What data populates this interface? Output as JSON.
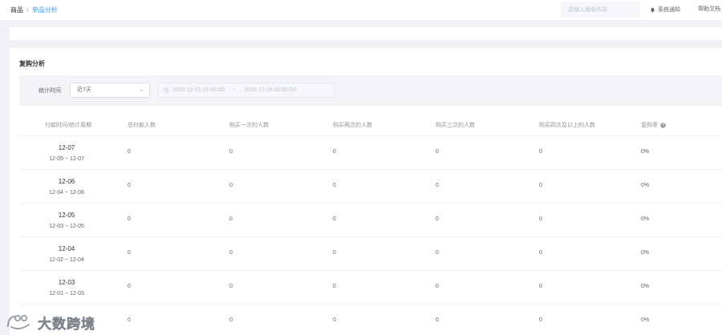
{
  "header": {
    "breadcrumb": {
      "root": "商品",
      "separator": "/",
      "current": "单品分析"
    },
    "search": {
      "placeholder": "请输入搜索内容",
      "value": ""
    },
    "notice_label": "系统通知",
    "help_label": "帮助文档"
  },
  "panel": {
    "title": "复购分析",
    "filter": {
      "label": "统计时间",
      "period": "近7天",
      "range_start": "2020-12-01 00:00:00",
      "range_separator": "~",
      "range_end": "2020-12-08 00:00:00"
    },
    "table": {
      "columns": [
        "付款时间/统计周期",
        "总付款人数",
        "购买一次的人数",
        "购买两次的人数",
        "购买三次的人数",
        "购买四次及以上的人数",
        "复购率"
      ],
      "rows": [
        {
          "period": "12-07",
          "range": "12-05 ~ 12-07",
          "total": "0",
          "once": "0",
          "twice": "0",
          "thrice": "0",
          "four_plus": "0",
          "rate": "0%"
        },
        {
          "period": "12-06",
          "range": "12-04 ~ 12-06",
          "total": "0",
          "once": "0",
          "twice": "0",
          "thrice": "0",
          "four_plus": "0",
          "rate": "0%"
        },
        {
          "period": "12-05",
          "range": "12-03 ~ 12-05",
          "total": "0",
          "once": "0",
          "twice": "0",
          "thrice": "0",
          "four_plus": "0",
          "rate": "0%"
        },
        {
          "period": "12-04",
          "range": "12-02 ~ 12-04",
          "total": "0",
          "once": "0",
          "twice": "0",
          "thrice": "0",
          "four_plus": "0",
          "rate": "0%"
        },
        {
          "period": "12-03",
          "range": "12-01 ~ 12-03",
          "total": "0",
          "once": "0",
          "twice": "0",
          "thrice": "0",
          "four_plus": "0",
          "rate": "0%"
        },
        {
          "period": "",
          "range": "",
          "total": "0",
          "once": "0",
          "twice": "0",
          "thrice": "0",
          "four_plus": "0",
          "rate": "0%"
        }
      ]
    }
  },
  "watermark": {
    "text": "大数跨境"
  },
  "icons": {
    "bell": "bell-icon",
    "chevron": "chevron-down-icon",
    "clock": "clock-icon",
    "help": "question-circle-icon",
    "logo": "watermark-logo-icon"
  },
  "colors": {
    "accent": "#409eff",
    "background": "#f0f2f5",
    "filter_bar": "#f2f4f7",
    "border": "#ebeef5"
  }
}
